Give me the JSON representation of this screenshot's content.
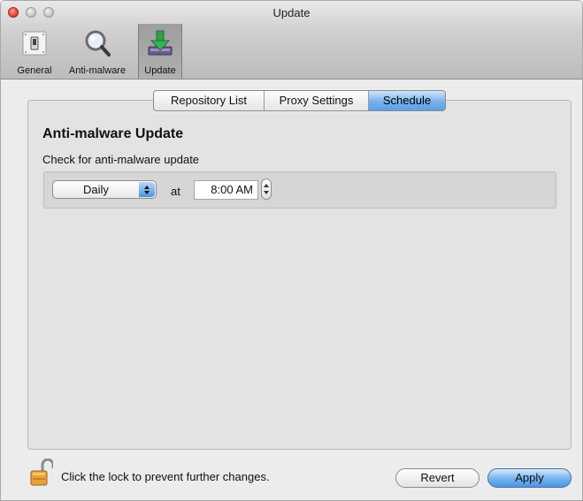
{
  "window": {
    "title": "Update"
  },
  "toolbar": {
    "items": [
      {
        "label": "General",
        "icon": "switch-icon",
        "selected": false
      },
      {
        "label": "Anti-malware",
        "icon": "magnifier-icon",
        "selected": false
      },
      {
        "label": "Update",
        "icon": "download-arrow-icon",
        "selected": true
      }
    ]
  },
  "tabs": [
    {
      "label": "Repository List",
      "active": false
    },
    {
      "label": "Proxy Settings",
      "active": false
    },
    {
      "label": "Schedule",
      "active": true
    }
  ],
  "schedule": {
    "heading": "Anti-malware Update",
    "subtext": "Check for anti-malware update",
    "frequency": "Daily",
    "at_label": "at",
    "time": "8:00 AM"
  },
  "footer": {
    "lock_text": "Click the lock to prevent further changes.",
    "revert_label": "Revert",
    "apply_label": "Apply"
  },
  "colors": {
    "accent": "#5d9ee6",
    "close_button": "#d83b2b"
  }
}
